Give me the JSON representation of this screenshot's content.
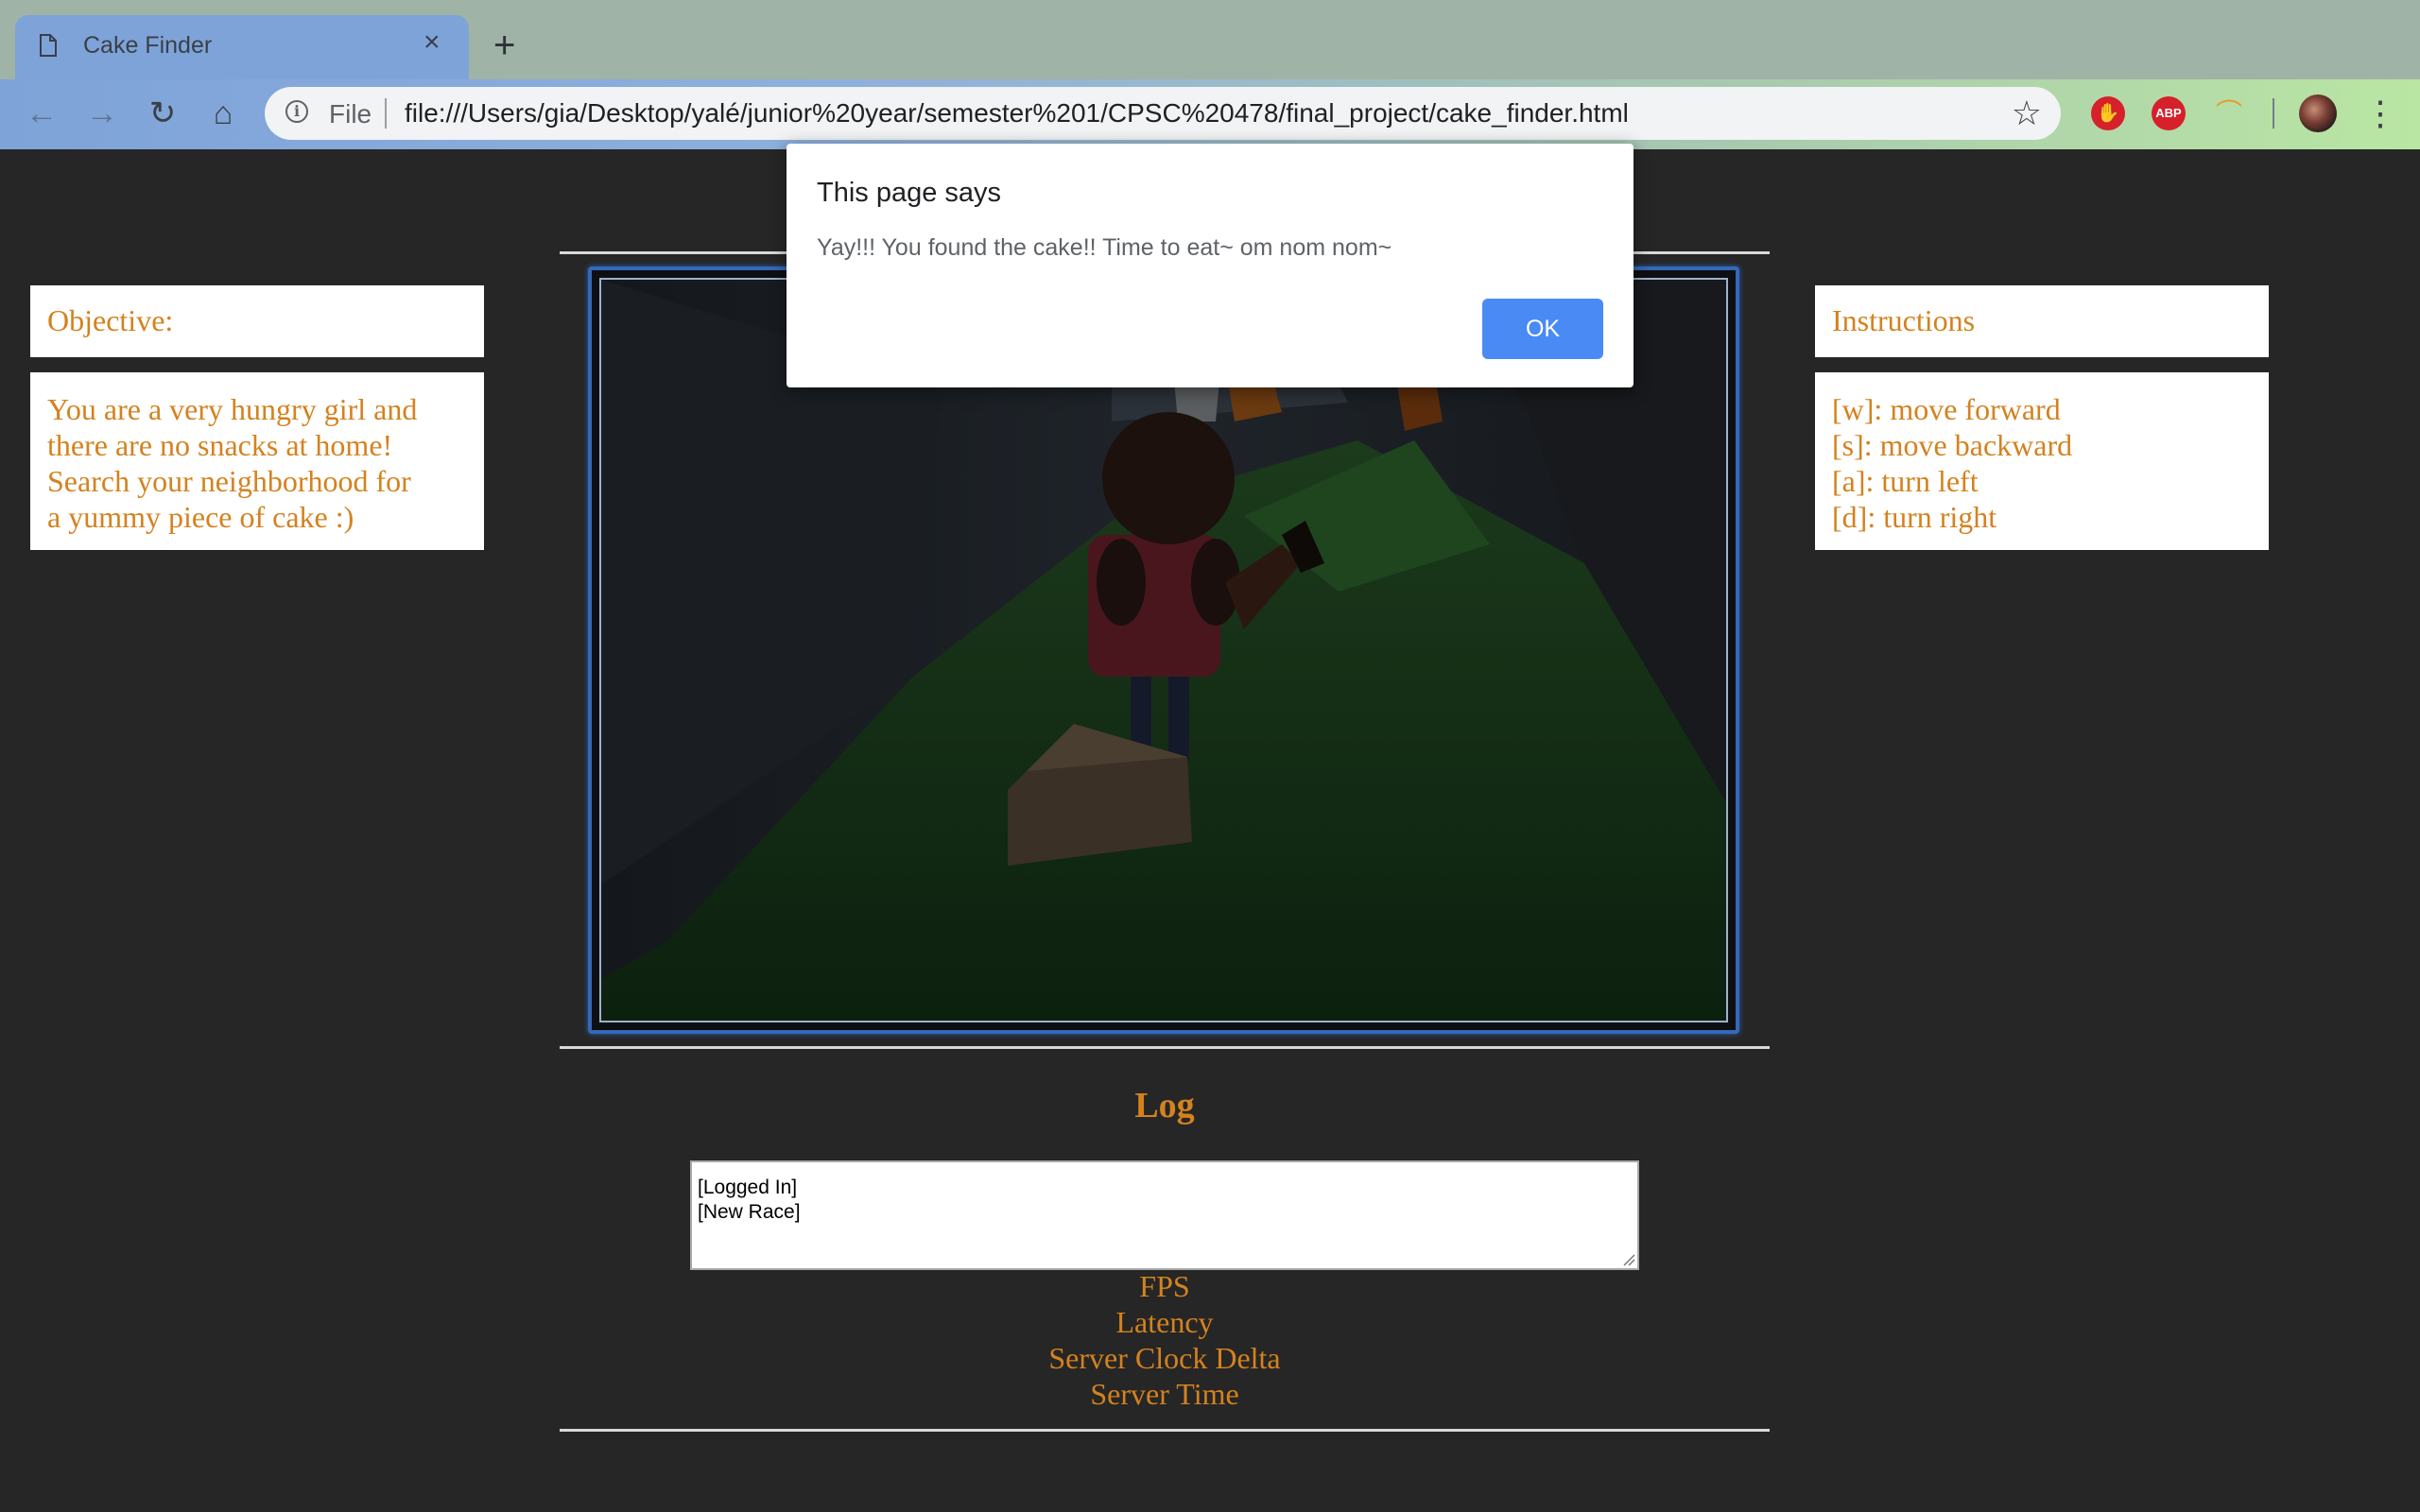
{
  "browser": {
    "tab_title": "Cake Finder",
    "tab_close": "×",
    "new_tab": "+",
    "back": "←",
    "forward": "→",
    "reload": "↻",
    "home": "⌂",
    "file_label": "File",
    "url": "file:///Users/gia/Desktop/yalé/junior%20year/semester%201/CPSC%20478/final_project/cake_finder.html",
    "bookmark": "☆",
    "ext_abp": "ABP",
    "menu": "⋮"
  },
  "objective": {
    "heading": "Objective:",
    "lines": [
      "You are a very hungry girl and",
      "there are no snacks at home!",
      "Search your neighborhood for",
      "a yummy piece of cake :)"
    ]
  },
  "instructions": {
    "heading": "Instructions",
    "lines": [
      "[w]: move forward",
      "[s]: move backward",
      "[a]: turn left",
      "[d]: turn right"
    ]
  },
  "log": {
    "title": "Log",
    "entries": [
      "[Logged In]",
      "[New Race]"
    ]
  },
  "stats": {
    "fps": "FPS",
    "latency": "Latency",
    "server_clock_delta": "Server Clock Delta",
    "server_time": "Server Time"
  },
  "dialog": {
    "title": "This page says",
    "message": "Yay!!! You found the cake!! Time to eat~ om nom nom~",
    "ok_label": "OK"
  },
  "colors": {
    "accent_text": "#d4821f",
    "page_bg": "#262626",
    "ok_button": "#4a8af4"
  }
}
